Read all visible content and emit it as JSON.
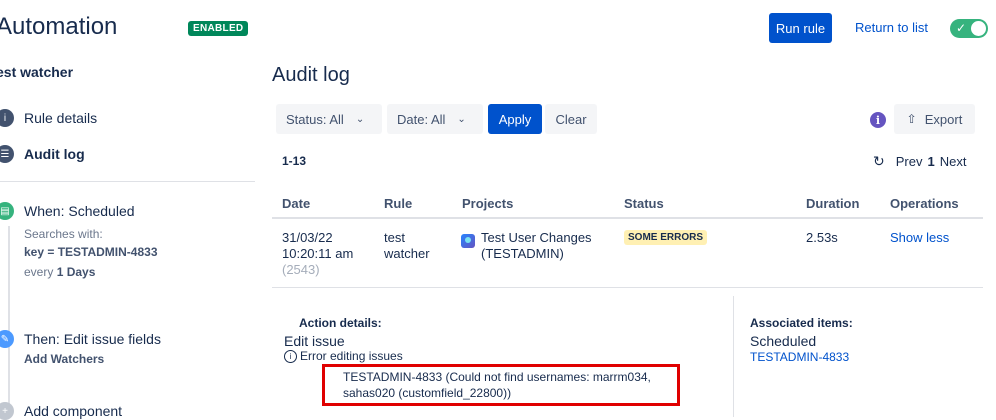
{
  "header": {
    "title": "Automation",
    "status_badge": "ENABLED",
    "run_rule": "Run rule",
    "return_to_list": "Return to list",
    "toggle_check": "✓",
    "accent_color": "#0052cc",
    "enabled_color": "#00875a"
  },
  "sidebar": {
    "rule_name": "est watcher",
    "nav": [
      {
        "label": "Rule details",
        "icon": "info-icon"
      },
      {
        "label": "Audit log",
        "icon": "list-icon"
      }
    ],
    "steps": [
      {
        "title": "When: Scheduled",
        "line1": "Searches with:",
        "line2": "key = TESTADMIN-4833",
        "line3_prefix": "every ",
        "line3_bold": "1 Days",
        "icon": "calendar-icon"
      },
      {
        "title": "Then: Edit issue fields",
        "line1": "Add Watchers",
        "icon": "pencil-icon"
      },
      {
        "title": "Add component",
        "icon": "plus-icon"
      }
    ]
  },
  "main": {
    "title": "Audit log",
    "filters": {
      "status": "Status: All",
      "date": "Date: All",
      "apply": "Apply",
      "clear": "Clear",
      "export": "Export",
      "info": "i"
    },
    "range": "1-13",
    "pager": {
      "prev": "Prev",
      "page": "1",
      "next": "Next"
    },
    "columns": [
      "Date",
      "Rule",
      "Projects",
      "Status",
      "Duration",
      "Operations"
    ],
    "row": {
      "date": "31/03/22",
      "time": "10:20:11 am",
      "id": "(2543)",
      "rule_line1": "test",
      "rule_line2": "watcher",
      "project_line1": "Test User Changes",
      "project_line2": "(TESTADMIN)",
      "status": "SOME ERRORS",
      "duration": "2.53s",
      "operation": "Show less"
    },
    "details": {
      "action_label": "Action details:",
      "action": "Edit issue",
      "error_title": "Error editing issues",
      "error_line1": "TESTADMIN-4833 (Could not find usernames: marrm034,",
      "error_line2": "sahas020 (customfield_22800))",
      "associated_label": "Associated items:",
      "associated_type": "Scheduled",
      "associated_key": "TESTADMIN-4833"
    }
  }
}
